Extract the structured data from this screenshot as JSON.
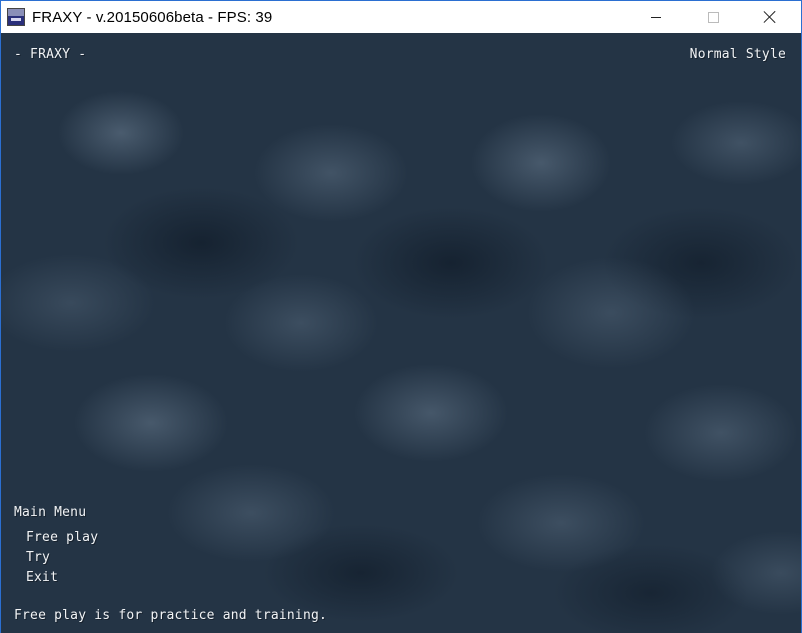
{
  "window": {
    "title": "FRAXY - v.20150606beta - FPS: 39"
  },
  "game": {
    "title": "- FRAXY -",
    "style_label": "Normal Style",
    "menu": {
      "heading": "Main Menu",
      "items": [
        "Free play",
        "Try",
        "Exit"
      ]
    },
    "hint": "Free play is for practice and training."
  }
}
